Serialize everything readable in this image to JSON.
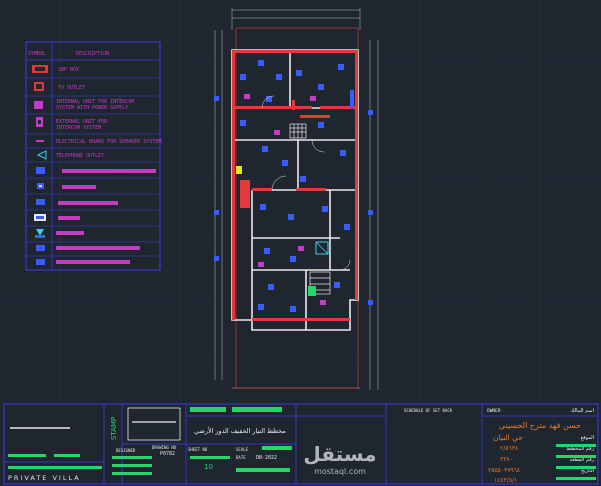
{
  "legend": {
    "header_symbol": "SYMBOL",
    "header_description": "DESCRIPTION",
    "items": [
      {
        "icon": "tv-box-icon",
        "label": "SBP BOX"
      },
      {
        "icon": "tv-outlet-icon",
        "label": "TV OUTLET"
      },
      {
        "icon": "intercom-internal-icon",
        "label": "INTERNAL UNIT FOR INTERCOM SYSTEM WITH POWER SUPPLY"
      },
      {
        "icon": "intercom-external-icon",
        "label": "EXTERNAL UNIT FOR INTERCOM SYSTEM"
      },
      {
        "icon": "speaker-outlet-icon",
        "label": "ELECTRICAL BOARD FOR SPEAKER SYSTEM"
      },
      {
        "icon": "telephone-outlet-icon",
        "label": "TELEPHONE OUTLET"
      }
    ]
  },
  "title_block": {
    "private_villa": "PRIVATE VILLA",
    "stamp": "STAMP",
    "designed_label": "DESIGNED",
    "drawing_no_label": "DRAWING NO",
    "drawing_no_value": "P0782",
    "sheet_label": "SHEET NO",
    "sheet_value": "10",
    "date_label": "DATE",
    "date_value": "DB-2022",
    "scale_label": "SCALE",
    "drawing_title_ar": "مخطط التيار الخفيف الدور الأرضي",
    "schedule_label": "SCHEDULE OF SET BACK",
    "owner_label": "OWNER",
    "owner_name_ar": "حسن فهد مترح الحسيني",
    "building_label_ar": "اسم المالك",
    "address_ar": "حي النيان",
    "watermark": "مستقل",
    "watermark_sub": "mostaql.com",
    "row_labels_ar": [
      "الموقع",
      "رقم المخطط",
      "رقم القطعة",
      "التاريخ"
    ],
    "row_values": [
      "٢/٥٦٣٨",
      "٣٣٨٠",
      "٢٥٥٥٠٣٧٩٦٤",
      "١٤٤٣/٥/١"
    ]
  },
  "colors": {
    "background": "#1f2630",
    "legend_border": "#3c3ce6",
    "wall": "#e23a3a",
    "accent": "#c43bc4",
    "green": "#22d86a",
    "blue": "#3a5cff"
  }
}
